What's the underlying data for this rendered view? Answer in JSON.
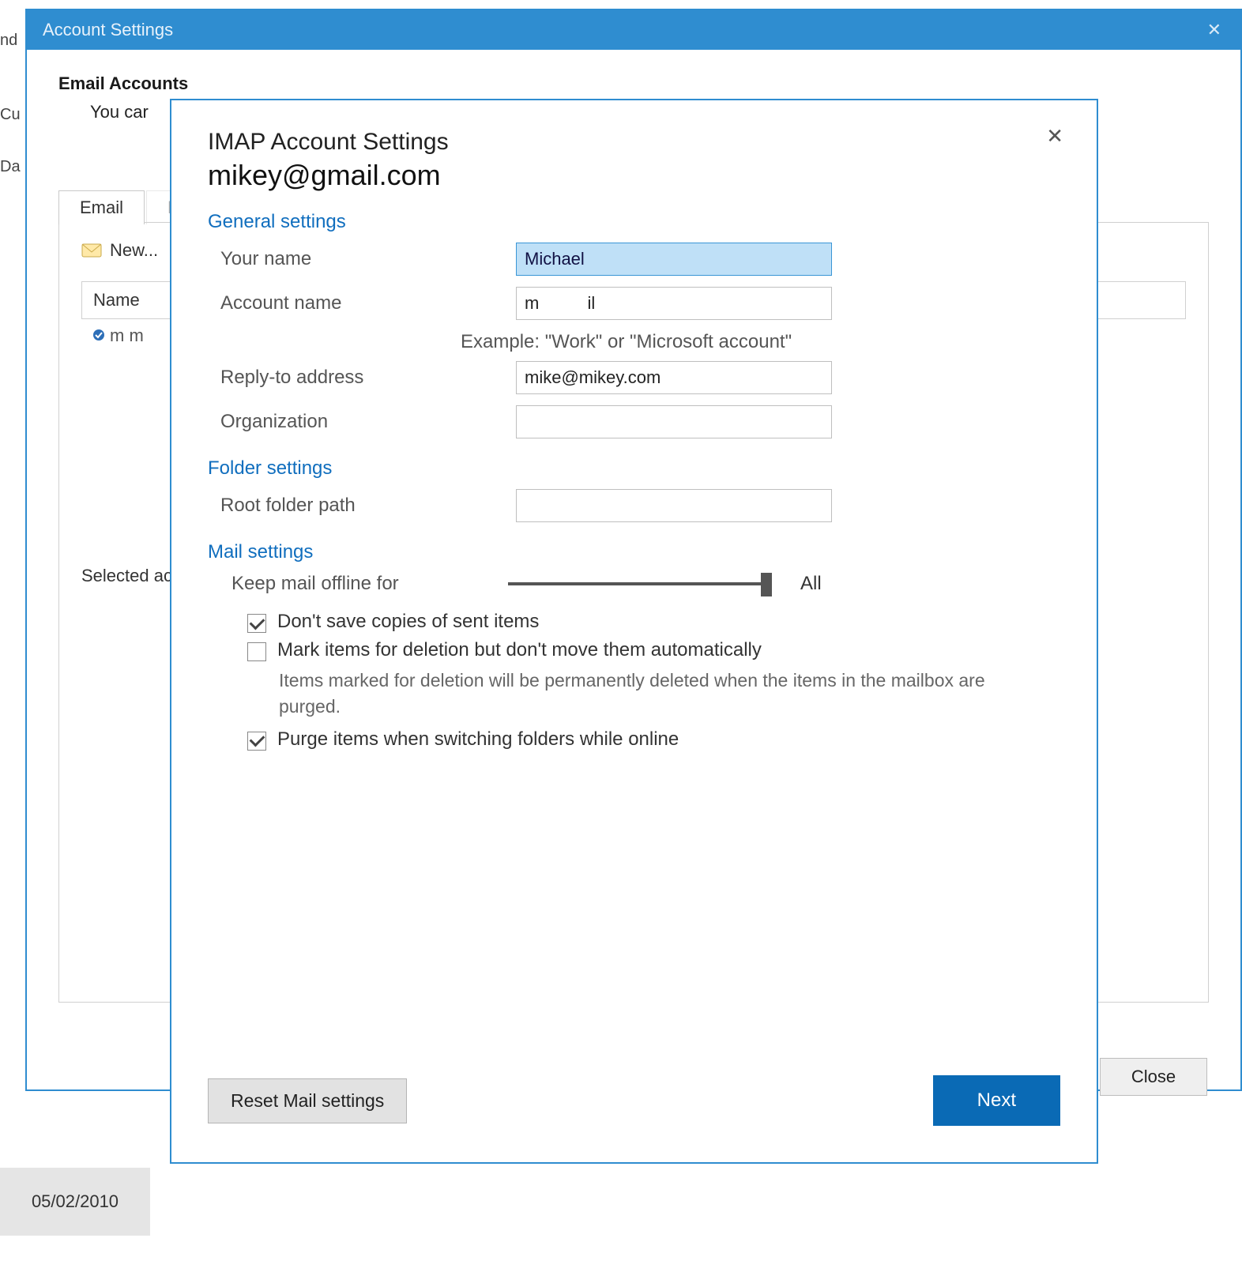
{
  "bg": {
    "label_nd": "nd",
    "label_cu": "Cu",
    "label_da": "Da",
    "date": "05/02/2010"
  },
  "account_settings": {
    "title": "Account Settings",
    "heading": "Email Accounts",
    "subtext": "You car",
    "tabs": {
      "email": "Email",
      "other": "D"
    },
    "new_label": "New...",
    "name_col": "Name",
    "row_item": "m        m",
    "selected_label": "Selected ac",
    "close_btn": "Close"
  },
  "imap": {
    "title": "IMAP Account Settings",
    "email": "mikey@gmail.com",
    "sections": {
      "general": "General settings",
      "folder": "Folder settings",
      "mail": "Mail settings"
    },
    "fields": {
      "your_name_label": "Your name",
      "your_name_value": "Michael",
      "account_name_label": "Account name",
      "account_name_value": "m          il",
      "account_name_hint": "Example: \"Work\" or \"Microsoft account\"",
      "reply_to_label": "Reply-to address",
      "reply_to_value": "mike@mikey.com",
      "organization_label": "Organization",
      "organization_value": "",
      "root_folder_label": "Root folder path",
      "root_folder_value": ""
    },
    "mail": {
      "offline_label": "Keep mail offline for",
      "offline_value": "All",
      "dont_save_sent": "Don't save copies of sent items",
      "mark_delete": "Mark items for deletion but don't move them automatically",
      "mark_help": "Items marked for deletion will be permanently deleted when the items in the mailbox are purged.",
      "purge": "Purge items when switching folders while online"
    },
    "buttons": {
      "reset": "Reset Mail settings",
      "next": "Next"
    }
  }
}
